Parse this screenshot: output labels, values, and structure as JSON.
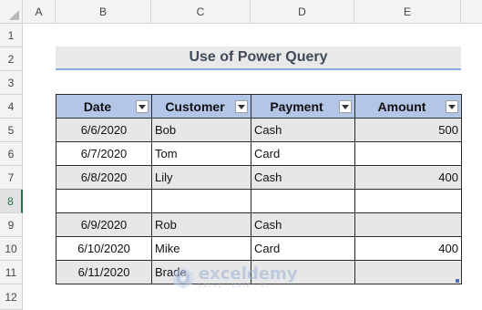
{
  "columns": [
    "A",
    "B",
    "C",
    "D",
    "E"
  ],
  "rows": [
    "1",
    "2",
    "3",
    "4",
    "5",
    "6",
    "7",
    "8",
    "9",
    "10",
    "11",
    "12"
  ],
  "title": "Use of Power Query",
  "table": {
    "headers": [
      "Date",
      "Customer",
      "Payment",
      "Amount"
    ],
    "rows": [
      {
        "date": "6/6/2020",
        "customer": "Bob",
        "payment": "Cash",
        "amount": "500"
      },
      {
        "date": "6/7/2020",
        "customer": "Tom",
        "payment": "Card",
        "amount": ""
      },
      {
        "date": "6/8/2020",
        "customer": "Lily",
        "payment": "Cash",
        "amount": "400"
      },
      {
        "date": "",
        "customer": "",
        "payment": "",
        "amount": ""
      },
      {
        "date": "6/9/2020",
        "customer": "Rob",
        "payment": "Cash",
        "amount": ""
      },
      {
        "date": "6/10/2020",
        "customer": "Mike",
        "payment": "Card",
        "amount": "400"
      },
      {
        "date": "6/11/2020",
        "customer": "Brade",
        "payment": "",
        "amount": ""
      }
    ]
  },
  "watermark": {
    "name": "exceldemy",
    "tagline": "EXCEL · DATA · BI"
  },
  "colors": {
    "header_fill": "#b4c6e7",
    "title_fill": "#e9e9e9",
    "band_fill": "#e7e7e7",
    "title_underline": "#8ea9db",
    "active_row": "#217346"
  },
  "active_row": "8"
}
